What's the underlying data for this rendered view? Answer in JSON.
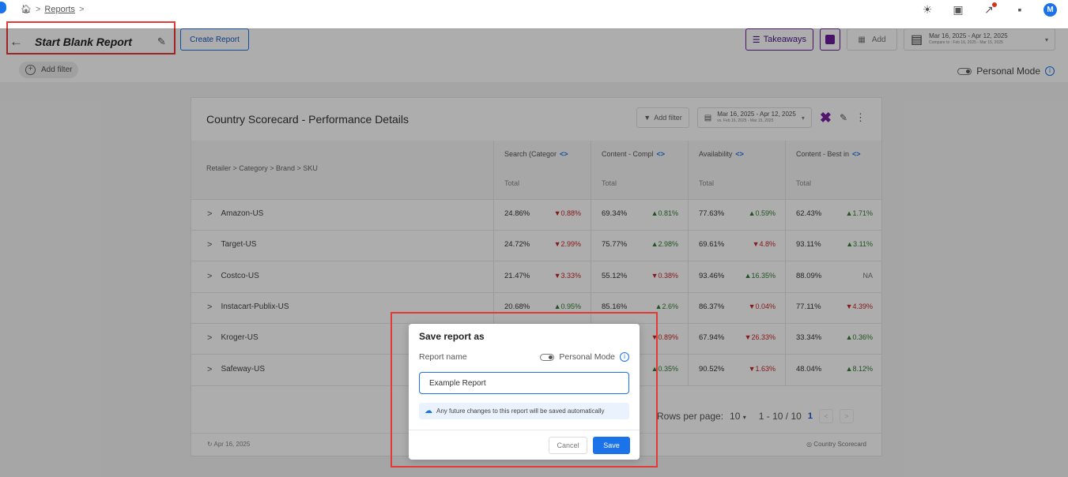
{
  "breadcrumb": {
    "items": [
      "Reports"
    ]
  },
  "header": {
    "title": "Start Blank Report",
    "create_label": "Create Report",
    "takeaways_label": "Takeaways",
    "add_label": "Add",
    "date_range": "Mar 16, 2025 - Apr 12, 2025",
    "compare_range": "Compare to : Feb 16, 2025 - Mar 15, 2025",
    "add_filter_label": "Add filter",
    "personal_mode_label": "Personal Mode"
  },
  "user": {
    "avatar_initial": "M"
  },
  "card": {
    "title": "Country Scorecard - Performance Details",
    "add_filter_label": "Add filter",
    "date_range": "Mar 16, 2025 - Apr 12, 2025",
    "compare_range": "vs. Feb 16, 2025 - Mar 15, 2025",
    "hierarchy_label": "Retailer > Category > Brand > SKU",
    "columns": [
      {
        "name": "Search (Categor",
        "sub": "Total"
      },
      {
        "name": "Content - Compl",
        "sub": "Total"
      },
      {
        "name": "Availability",
        "sub": "Total"
      },
      {
        "name": "Content - Best in",
        "sub": "Total"
      }
    ],
    "rows": [
      {
        "label": "Amazon-US",
        "cells": [
          {
            "value": "24.86%",
            "change": "▼0.88%",
            "dir": "down"
          },
          {
            "value": "69.34%",
            "change": "▲0.81%",
            "dir": "up"
          },
          {
            "value": "77.63%",
            "change": "▲0.59%",
            "dir": "up"
          },
          {
            "value": "62.43%",
            "change": "▲1.71%",
            "dir": "up"
          }
        ]
      },
      {
        "label": "Target-US",
        "cells": [
          {
            "value": "24.72%",
            "change": "▼2.99%",
            "dir": "down"
          },
          {
            "value": "75.77%",
            "change": "▲2.98%",
            "dir": "up"
          },
          {
            "value": "69.61%",
            "change": "▼4.8%",
            "dir": "down"
          },
          {
            "value": "93.11%",
            "change": "▲3.11%",
            "dir": "up"
          }
        ]
      },
      {
        "label": "Costco-US",
        "cells": [
          {
            "value": "21.47%",
            "change": "▼3.33%",
            "dir": "down"
          },
          {
            "value": "55.12%",
            "change": "▼0.38%",
            "dir": "down"
          },
          {
            "value": "93.46%",
            "change": "▲16.35%",
            "dir": "up"
          },
          {
            "value": "88.09%",
            "change": "NA",
            "dir": "na"
          }
        ]
      },
      {
        "label": "Instacart-Publix-US",
        "cells": [
          {
            "value": "20.68%",
            "change": "▲0.95%",
            "dir": "up"
          },
          {
            "value": "85.16%",
            "change": "▲2.6%",
            "dir": "up"
          },
          {
            "value": "86.37%",
            "change": "▼0.04%",
            "dir": "down"
          },
          {
            "value": "77.11%",
            "change": "▼4.39%",
            "dir": "down"
          }
        ]
      },
      {
        "label": "Kroger-US",
        "cells": [
          {
            "value": "",
            "change": "",
            "dir": "na"
          },
          {
            "value": "",
            "change": "▼0.89%",
            "dir": "down"
          },
          {
            "value": "67.94%",
            "change": "▼26.33%",
            "dir": "down"
          },
          {
            "value": "33.34%",
            "change": "▲0.36%",
            "dir": "up"
          }
        ]
      },
      {
        "label": "Safeway-US",
        "cells": [
          {
            "value": "",
            "change": "",
            "dir": "na"
          },
          {
            "value": "",
            "change": "▲0.35%",
            "dir": "up"
          },
          {
            "value": "90.52%",
            "change": "▼1.63%",
            "dir": "down"
          },
          {
            "value": "48.04%",
            "change": "▲8.12%",
            "dir": "up"
          }
        ]
      }
    ],
    "pagination": {
      "rows_per_page_label": "Rows per page:",
      "rows_per_page": "10",
      "range": "1 - 10 / 10",
      "current_page": "1"
    },
    "footer_date": "Apr 16, 2025",
    "footer_source": "Country Scorecard"
  },
  "modal": {
    "title": "Save report as",
    "name_label": "Report name",
    "personal_mode_label": "Personal Mode",
    "input_value": "Example Report",
    "info_text": "Any future changes to this report will be saved automatically",
    "cancel_label": "Cancel",
    "save_label": "Save"
  }
}
